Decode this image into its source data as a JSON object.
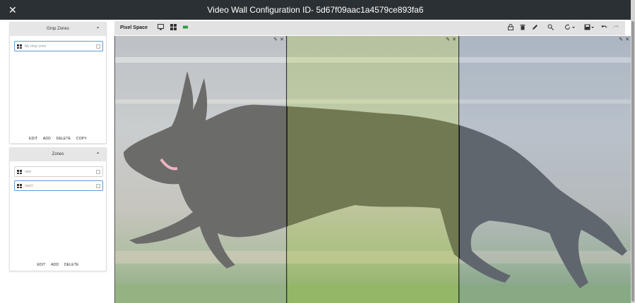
{
  "window": {
    "title": "Video Wall Configuration ID- 5d67f09aac1a4579ce893fa6",
    "close_icon": "close-icon"
  },
  "group_zones": {
    "header": "Grop Zones",
    "items": [
      {
        "label": "My drop zone",
        "selected": true
      }
    ],
    "actions": [
      "EDIT",
      "ADD",
      "DELETE",
      "COPY"
    ]
  },
  "zones": {
    "header": "Zones",
    "items": [
      {
        "label": "new",
        "selected": false
      },
      {
        "label": "new1",
        "selected": true
      }
    ],
    "actions": [
      "EDIT",
      "ADD",
      "DELETE"
    ]
  },
  "toolbar": {
    "title": "Pixel Space",
    "left_icons": [
      "monitor-icon",
      "grid-icon",
      "display-active-icon"
    ],
    "right_icons": [
      "lock-icon",
      "trash-icon",
      "pencil-icon",
      "zoom-icon",
      "rotate-dropdown-icon",
      "save-dropdown-icon",
      "undo-icon",
      "redo-icon"
    ],
    "active_color": "#2e9e44"
  },
  "canvas": {
    "displays": [
      {
        "name": "display-1",
        "tint": "rgba(255,255,255,0.35)"
      },
      {
        "name": "display-2",
        "tint": "rgba(215,235,150,0.45)"
      },
      {
        "name": "display-3",
        "tint": "rgba(200,215,235,0.40)"
      }
    ],
    "display_controls": [
      "pencil-icon",
      "close-icon"
    ],
    "image": "black dog running on grass"
  }
}
